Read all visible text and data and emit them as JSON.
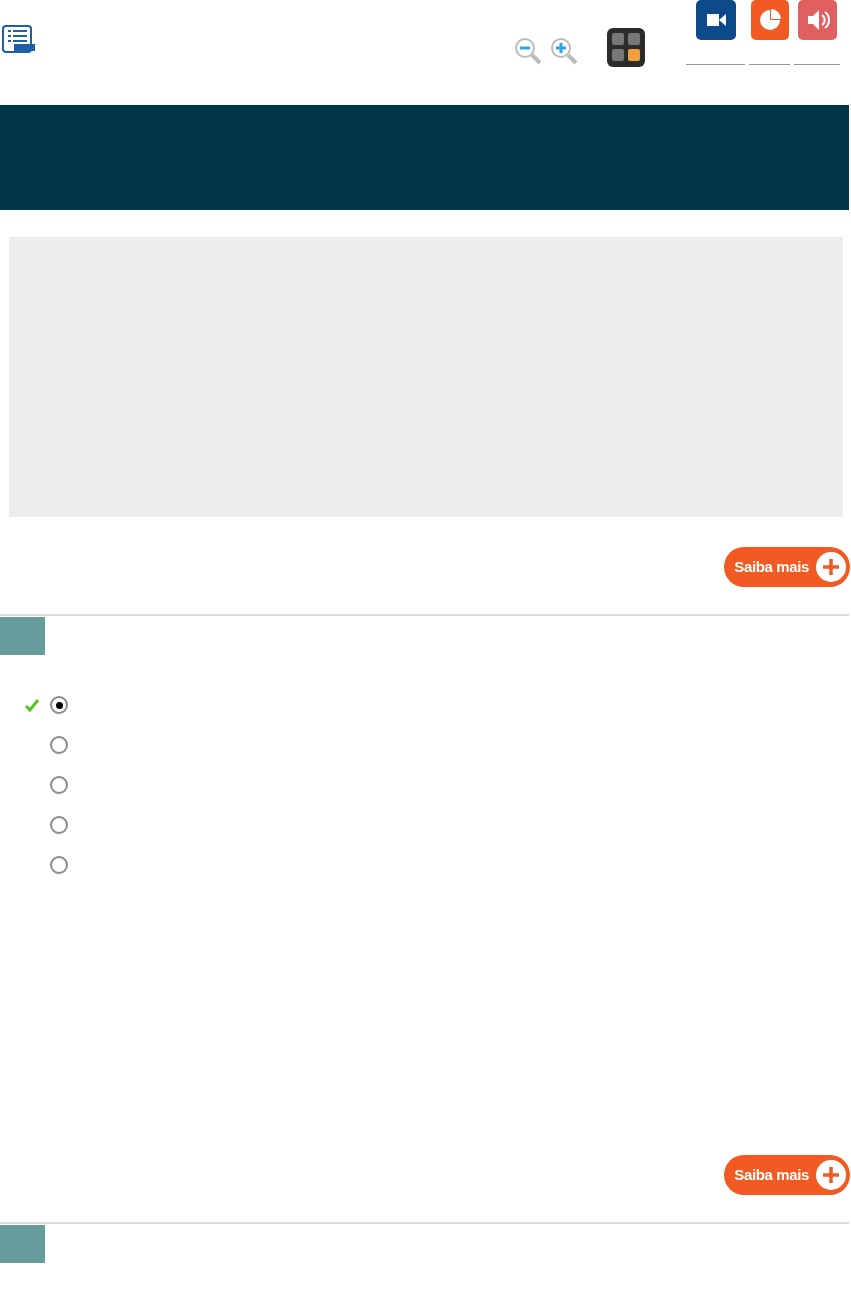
{
  "intro": {
    "more_button": "Saiba mais"
  },
  "questions": [
    {
      "options": [
        {
          "selected": true,
          "correct": true
        },
        {
          "selected": false,
          "correct": false
        },
        {
          "selected": false,
          "correct": false
        },
        {
          "selected": false,
          "correct": false
        },
        {
          "selected": false,
          "correct": false
        }
      ],
      "more_button": "Saiba mais"
    }
  ]
}
